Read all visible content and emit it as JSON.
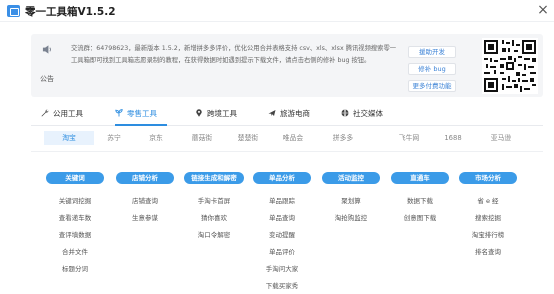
{
  "window": {
    "title": "零一工具箱V1.5.2",
    "close": "×"
  },
  "notice": {
    "label": "公告",
    "text": "交流群：64798623，最新版本 1.5.2，新增拼多多评价，优化公用合并表格支持 csv、xls、xlsx 腾讯视频搜索零一工具箱即可找到工具箱志愿录制的教程，在获得数据时如遇到提示下载文件，请点击右侧的修补 bug 按钮。",
    "buttons": [
      "援助开发",
      "修补 bug",
      "更多付费功能"
    ]
  },
  "tabs": [
    {
      "label": "公用工具",
      "icon": "wrench-icon"
    },
    {
      "label": "零售工具",
      "icon": "sprout-icon"
    },
    {
      "label": "跨境工具",
      "icon": "location-pin-icon"
    },
    {
      "label": "旅游电商",
      "icon": "airplane-icon"
    },
    {
      "label": "社交媒体",
      "icon": "globe-icon"
    }
  ],
  "active_tab": "零售工具",
  "platforms": [
    "淘宝",
    "苏宁",
    "京东",
    "蘑菇街",
    "楚楚街",
    "唯品会",
    "拼多多",
    "飞牛网",
    "1688",
    "亚马逊"
  ],
  "active_platform": "淘宝",
  "columns": [
    {
      "head": "关键词",
      "items": [
        "关键词挖掘",
        "查看递车数",
        "查评填数据",
        "合并文件",
        "标题分词"
      ]
    },
    {
      "head": "店铺分析",
      "items": [
        "店铺查询",
        "生意参谋"
      ]
    },
    {
      "head": "链接生成和解密",
      "items": [
        "手淘卡首屏",
        "猜你喜欢",
        "淘口令解密"
      ]
    },
    {
      "head": "单品分析",
      "items": [
        "单品跟踪",
        "单品查询",
        "变动提醒",
        "单品评价",
        "手淘问大家",
        "下载买家秀"
      ]
    },
    {
      "head": "活动监控",
      "items": [
        "聚划算",
        "淘抢购监控"
      ]
    },
    {
      "head": "直通车",
      "items": [
        "数据下载",
        "创意图下载"
      ]
    },
    {
      "head": "市场分析",
      "items": [
        "省 e 经",
        "搜索挖掘",
        "淘宝排行榜",
        "排名查询"
      ]
    }
  ],
  "colors": {
    "accent": "#2d8de0",
    "column_head": "#3b9be8",
    "active_platform_bg": "#e8f2fd"
  }
}
